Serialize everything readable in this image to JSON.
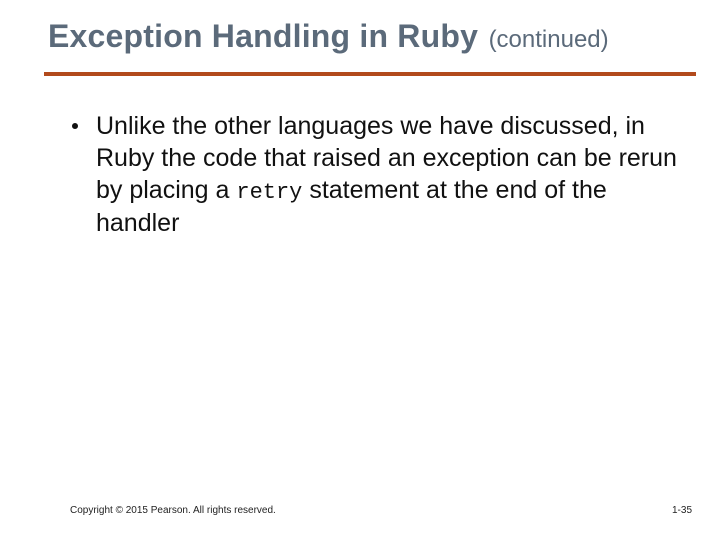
{
  "title": {
    "main": "Exception Handling in Ruby",
    "sub": "(continued)"
  },
  "bullets": [
    {
      "pre": "Unlike the other languages we have discussed, in Ruby the code that raised an exception can be rerun by placing a ",
      "code": "retry",
      "post": " statement at the end of the handler"
    }
  ],
  "footer": {
    "copyright": "Copyright © 2015 Pearson. All rights reserved.",
    "page": "1-35"
  },
  "colors": {
    "heading": "#5b6a7a",
    "rule": "#b24a1c"
  }
}
